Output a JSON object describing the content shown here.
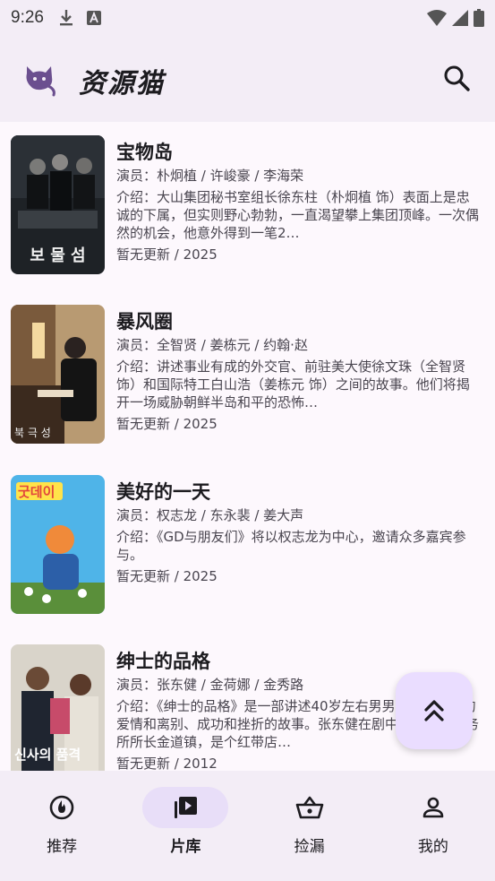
{
  "status_bar": {
    "time": "9:26",
    "icons": [
      "download-icon",
      "font-icon",
      "wifi-icon",
      "signal-icon",
      "battery-icon"
    ]
  },
  "app_bar": {
    "title": "资源猫",
    "logo_icon": "cat-logo-icon",
    "search_icon": "search-icon"
  },
  "movies": [
    {
      "title": "宝物岛",
      "cast": "演员：朴炯植 / 许峻豪 / 李海荣",
      "desc": "介绍：大山集团秘书室组长徐东柱（朴炯植 饰）表面上是忠诚的下属，但实则野心勃勃，一直渴望攀上集团顶峰。一次偶然的机会，他意外得到一笔2…",
      "meta": "暂无更新 / 2025",
      "poster_text": "보 물 섬"
    },
    {
      "title": "暴风圈",
      "cast": "演员：全智贤 / 姜栋元 / 约翰·赵",
      "desc": "介绍：讲述事业有成的外交官、前驻美大使徐文珠（全智贤 饰）和国际特工白山浩（姜栋元 饰）之间的故事。他们将揭开一场威胁朝鲜半岛和平的恐怖…",
      "meta": "暂无更新 / 2025",
      "poster_text": "북 극 성"
    },
    {
      "title": "美好的一天",
      "cast": "演员：权志龙 / 东永裴 / 姜大声",
      "desc": "介绍：《GD与朋友们》将以权志龙为中心，邀请众多嘉宾参与。",
      "meta": "暂无更新 / 2025",
      "poster_text": "굿데이"
    },
    {
      "title": "绅士的品格",
      "cast": "演员：张东健 / 金荷娜 / 金秀路",
      "desc": "介绍：《绅士的品格》是一部讲述40岁左右男男女女，他们的爱情和离别、成功和挫折的故事。张东健在剧中饰演建筑事务所所长金道镇，是个红带店…",
      "meta": "暂无更新 / 2012",
      "poster_text": "신사의 품격"
    }
  ],
  "fab": {
    "icon": "double-chevron-up-icon"
  },
  "bottom_nav": {
    "active_index": 1,
    "items": [
      {
        "label": "推荐",
        "icon": "recommend-icon"
      },
      {
        "label": "片库",
        "icon": "video-library-icon"
      },
      {
        "label": "捡漏",
        "icon": "basket-icon"
      },
      {
        "label": "我的",
        "icon": "person-icon"
      }
    ]
  },
  "colors": {
    "bar_bg": "#f3edf6",
    "page_bg": "#fdf8fd",
    "accent_container": "#eaddff",
    "nav_indicator": "#e8def8",
    "logo_purple": "#6b4f8f"
  }
}
